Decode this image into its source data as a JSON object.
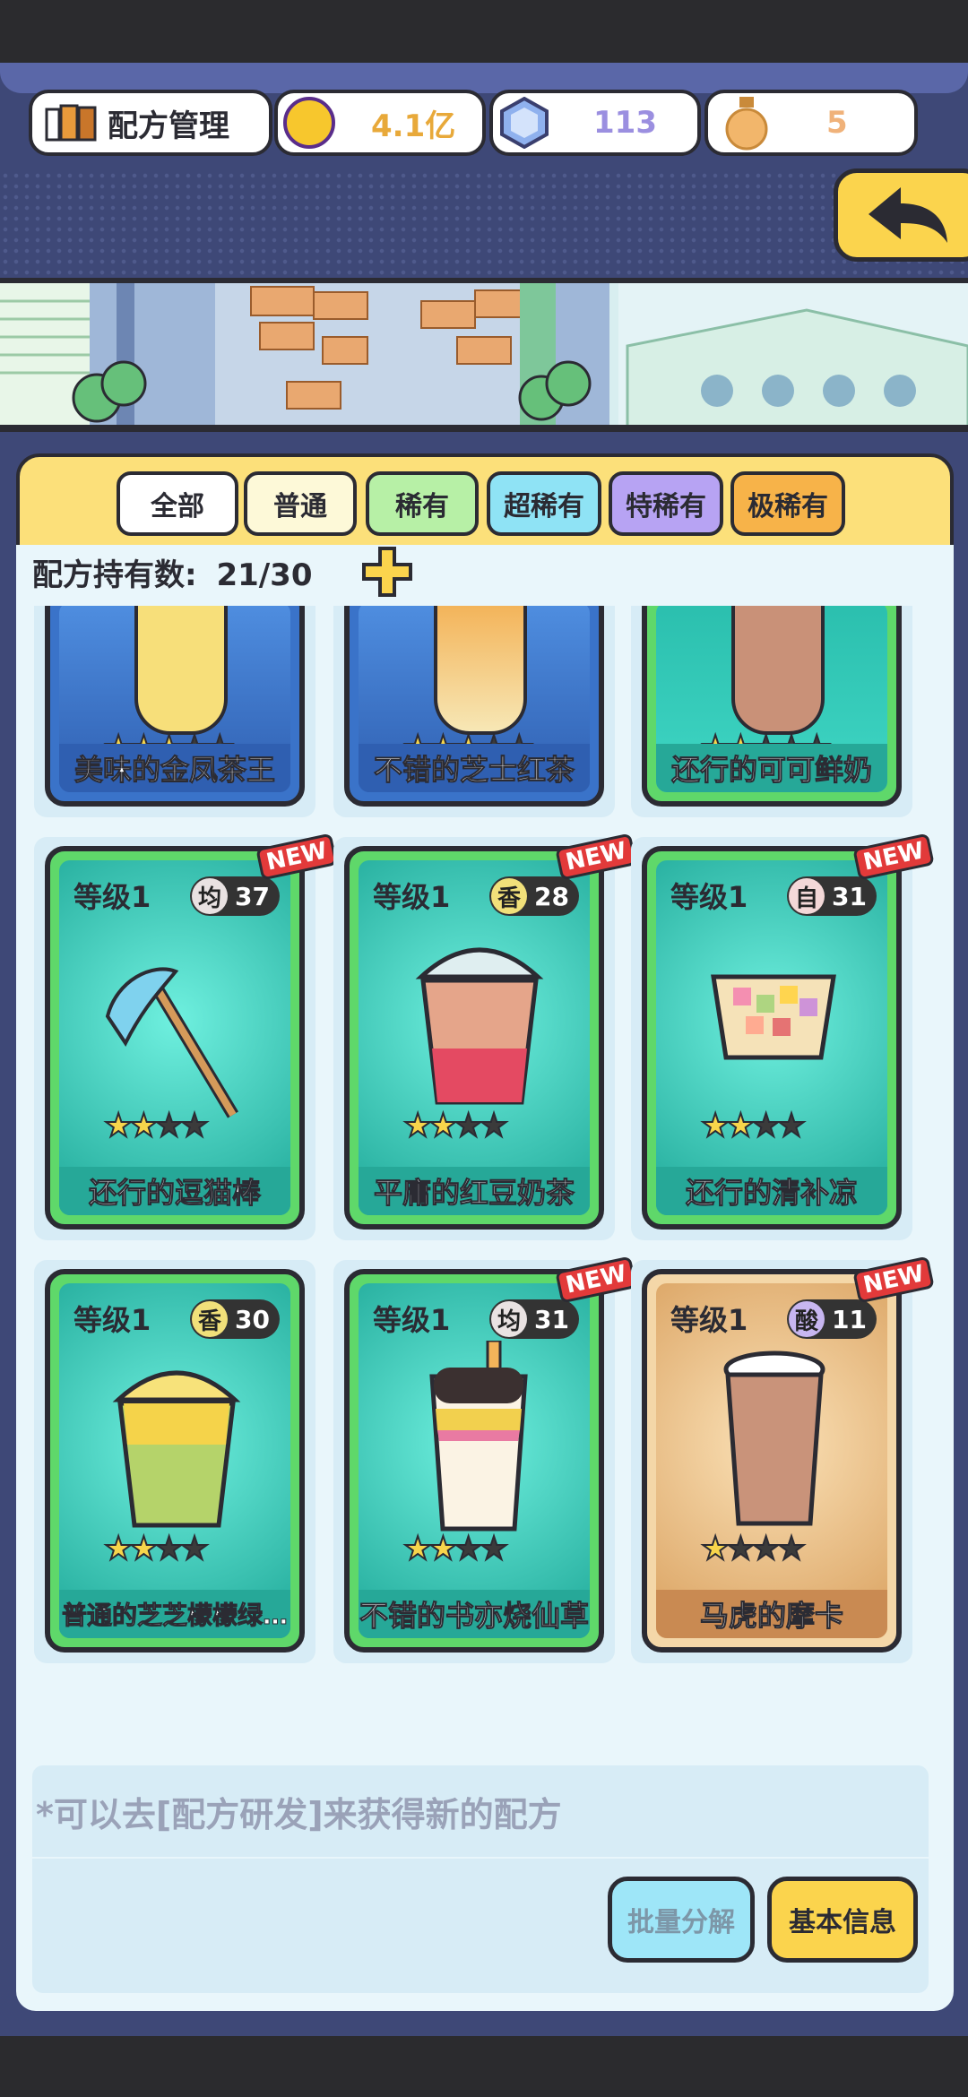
{
  "header": {
    "title": "配方管理",
    "gold": "4.1亿",
    "gems": "113",
    "potion": "5"
  },
  "tabs": [
    {
      "label": "全部",
      "color": "#ffffff"
    },
    {
      "label": "普通",
      "color": "#fdf9d8"
    },
    {
      "label": "稀有",
      "color": "#b7f0a6"
    },
    {
      "label": "超稀有",
      "color": "#8fe3f5"
    },
    {
      "label": "特稀有",
      "color": "#b7a3f3"
    },
    {
      "label": "极稀有",
      "color": "#f7b349"
    }
  ],
  "recipe_count": {
    "label": "配方持有数:",
    "value": "21/30"
  },
  "top_row": [
    {
      "name": "美味的金凤茶王",
      "stars": 3,
      "max": 5,
      "rarity": "blue"
    },
    {
      "name": "不错的芝士红茶",
      "stars": 3,
      "max": 5,
      "rarity": "blue"
    },
    {
      "name": "还行的可可鲜奶",
      "stars": 2,
      "max": 5,
      "rarity": "teal"
    }
  ],
  "cards": [
    {
      "level": "等级1",
      "badge_char": "均",
      "badge_value": "37",
      "name": "还行的逗猫棒",
      "stars": 2,
      "max": 4,
      "new": "NEW",
      "rarity": "teal",
      "item": "feather-wand"
    },
    {
      "level": "等级1",
      "badge_char": "香",
      "badge_value": "28",
      "name": "平庸的红豆奶茶",
      "stars": 2,
      "max": 4,
      "new": "NEW",
      "rarity": "teal",
      "item": "red-bean-milk-tea"
    },
    {
      "level": "等级1",
      "badge_char": "自",
      "badge_value": "31",
      "name": "还行的清补凉",
      "stars": 2,
      "max": 4,
      "new": "NEW",
      "rarity": "teal",
      "item": "cheng-teng"
    },
    {
      "level": "等级1",
      "badge_char": "香",
      "badge_value": "30",
      "name": "普通的芝芝檬檬绿…",
      "stars": 2,
      "max": 4,
      "new": "",
      "rarity": "teal",
      "item": "cheese-lemon-green"
    },
    {
      "level": "等级1",
      "badge_char": "均",
      "badge_value": "31",
      "name": "不错的书亦烧仙草",
      "stars": 2,
      "max": 4,
      "new": "NEW",
      "rarity": "teal",
      "item": "grass-jelly"
    },
    {
      "level": "等级1",
      "badge_char": "酸",
      "badge_value": "11",
      "name": "马虎的摩卡",
      "stars": 1,
      "max": 4,
      "new": "NEW",
      "rarity": "tan",
      "item": "mocha"
    }
  ],
  "hint": "*可以去[配方研发]来获得新的配方",
  "buttons": {
    "batch": "批量分解",
    "info": "基本信息"
  },
  "colors": {
    "teal": "#34c7b3",
    "blue": "#3a73c9",
    "tan": "#e9b677",
    "green_border": "#5fd86a",
    "yellow": "#fbd44d"
  }
}
